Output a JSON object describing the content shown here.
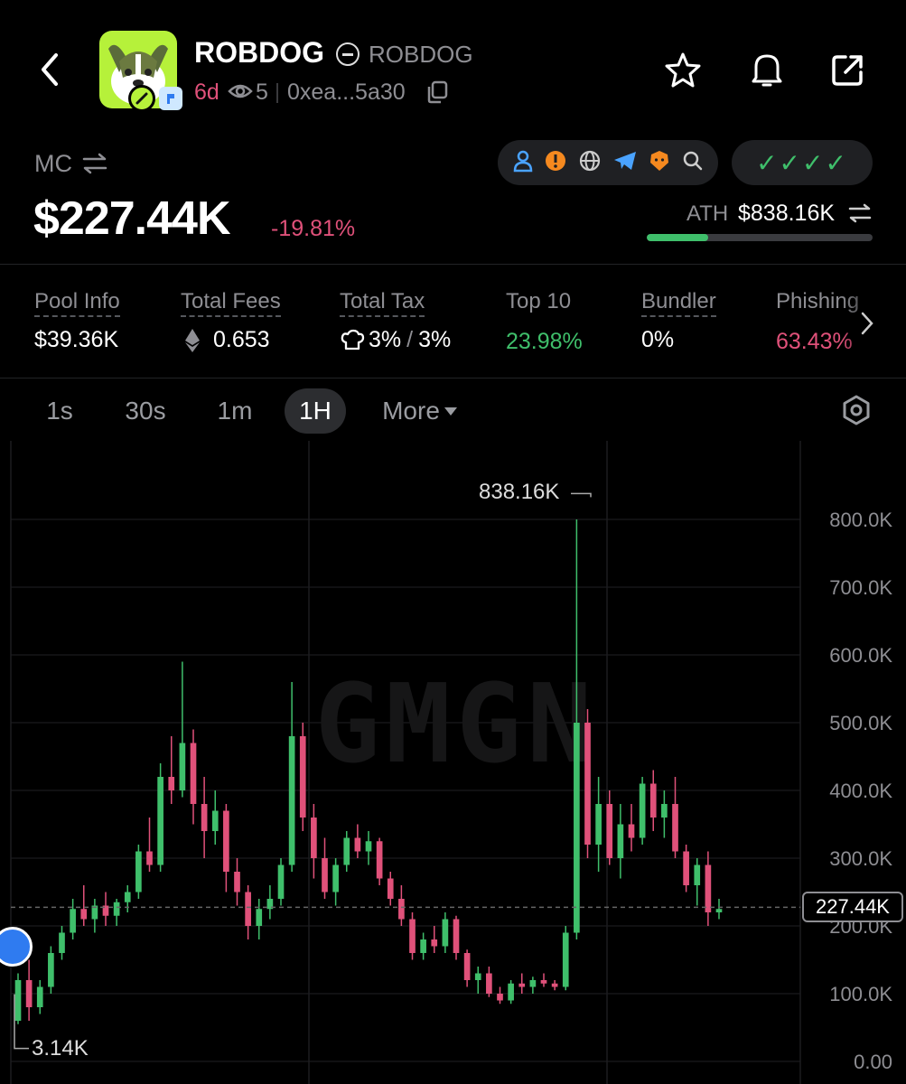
{
  "header": {
    "token_name": "ROBDOG",
    "token_ticker": "ROBDOG",
    "age": "6d",
    "watchers": "5",
    "address": "0xea...5a30"
  },
  "market": {
    "mc_label": "MC",
    "mc_value": "$227.44K",
    "change": "-19.81%",
    "ath_label": "ATH",
    "ath_value": "$838.16K",
    "ath_progress": 0.27,
    "checks": "✓✓✓✓"
  },
  "stats": [
    {
      "label": "Pool Info",
      "value": "$39.36K"
    },
    {
      "label": "Total Fees",
      "value": "0.653"
    },
    {
      "label": "Total Tax",
      "value_buy": "3%",
      "sep": "/",
      "value_sell": "3%"
    },
    {
      "label": "Top 10",
      "value": "23.98%"
    },
    {
      "label": "Bundler",
      "value": "0%"
    },
    {
      "label": "Phishing",
      "value": "63.43%"
    }
  ],
  "timeframes": {
    "items": [
      "1s",
      "30s",
      "1m",
      "1H"
    ],
    "active": "1H",
    "more": "More"
  },
  "chart_data": {
    "type": "candlestick",
    "watermark": "GMGN",
    "y_ticks": [
      "800.0K",
      "700.0K",
      "600.0K",
      "500.0K",
      "400.0K",
      "300.0K",
      "200.0K",
      "100.0K",
      "0.00"
    ],
    "ylim": [
      0,
      800000
    ],
    "current_price_label": "227.44K",
    "current_value": 227440,
    "high_label": "838.16K",
    "high_value": 838160,
    "low_label": "3.14K",
    "low_value": 3140,
    "colors": {
      "up": "#3fbf6b",
      "down": "#e0517a"
    },
    "series": [
      [
        60000,
        130000,
        55000,
        120000
      ],
      [
        120000,
        150000,
        60000,
        80000
      ],
      [
        80000,
        120000,
        70000,
        110000
      ],
      [
        110000,
        170000,
        100000,
        160000
      ],
      [
        160000,
        200000,
        150000,
        190000
      ],
      [
        190000,
        240000,
        180000,
        225000
      ],
      [
        225000,
        260000,
        200000,
        210000
      ],
      [
        210000,
        240000,
        190000,
        230000
      ],
      [
        230000,
        250000,
        200000,
        215000
      ],
      [
        215000,
        240000,
        200000,
        235000
      ],
      [
        235000,
        260000,
        220000,
        250000
      ],
      [
        250000,
        320000,
        240000,
        310000
      ],
      [
        310000,
        360000,
        280000,
        290000
      ],
      [
        290000,
        440000,
        280000,
        420000
      ],
      [
        420000,
        480000,
        380000,
        400000
      ],
      [
        400000,
        590000,
        390000,
        470000
      ],
      [
        470000,
        490000,
        350000,
        380000
      ],
      [
        380000,
        420000,
        300000,
        340000
      ],
      [
        340000,
        400000,
        320000,
        370000
      ],
      [
        370000,
        380000,
        250000,
        280000
      ],
      [
        280000,
        300000,
        230000,
        250000
      ],
      [
        250000,
        260000,
        180000,
        200000
      ],
      [
        200000,
        240000,
        180000,
        225000
      ],
      [
        225000,
        260000,
        210000,
        240000
      ],
      [
        240000,
        300000,
        230000,
        290000
      ],
      [
        290000,
        560000,
        280000,
        480000
      ],
      [
        480000,
        500000,
        340000,
        360000
      ],
      [
        360000,
        380000,
        270000,
        300000
      ],
      [
        300000,
        330000,
        240000,
        250000
      ],
      [
        250000,
        300000,
        230000,
        290000
      ],
      [
        290000,
        340000,
        280000,
        330000
      ],
      [
        330000,
        350000,
        300000,
        310000
      ],
      [
        310000,
        340000,
        290000,
        325000
      ],
      [
        325000,
        330000,
        260000,
        270000
      ],
      [
        270000,
        280000,
        230000,
        240000
      ],
      [
        240000,
        260000,
        200000,
        210000
      ],
      [
        210000,
        220000,
        150000,
        160000
      ],
      [
        160000,
        190000,
        150000,
        180000
      ],
      [
        180000,
        200000,
        160000,
        170000
      ],
      [
        170000,
        220000,
        160000,
        210000
      ],
      [
        210000,
        215000,
        150000,
        160000
      ],
      [
        160000,
        165000,
        110000,
        120000
      ],
      [
        120000,
        140000,
        100000,
        130000
      ],
      [
        130000,
        140000,
        95000,
        100000
      ],
      [
        100000,
        110000,
        85000,
        90000
      ],
      [
        90000,
        120000,
        85000,
        115000
      ],
      [
        115000,
        130000,
        100000,
        110000
      ],
      [
        110000,
        125000,
        100000,
        120000
      ],
      [
        120000,
        130000,
        110000,
        115000
      ],
      [
        115000,
        120000,
        105000,
        110000
      ],
      [
        110000,
        200000,
        105000,
        190000
      ],
      [
        190000,
        800000,
        180000,
        500000
      ],
      [
        500000,
        520000,
        300000,
        320000
      ],
      [
        320000,
        420000,
        280000,
        380000
      ],
      [
        380000,
        400000,
        290000,
        300000
      ],
      [
        300000,
        380000,
        270000,
        350000
      ],
      [
        350000,
        380000,
        310000,
        330000
      ],
      [
        330000,
        420000,
        320000,
        410000
      ],
      [
        410000,
        430000,
        340000,
        360000
      ],
      [
        360000,
        400000,
        330000,
        380000
      ],
      [
        380000,
        420000,
        300000,
        310000
      ],
      [
        310000,
        320000,
        250000,
        260000
      ],
      [
        260000,
        300000,
        230000,
        290000
      ],
      [
        290000,
        310000,
        200000,
        220000
      ],
      [
        220000,
        240000,
        210000,
        225000
      ]
    ]
  }
}
